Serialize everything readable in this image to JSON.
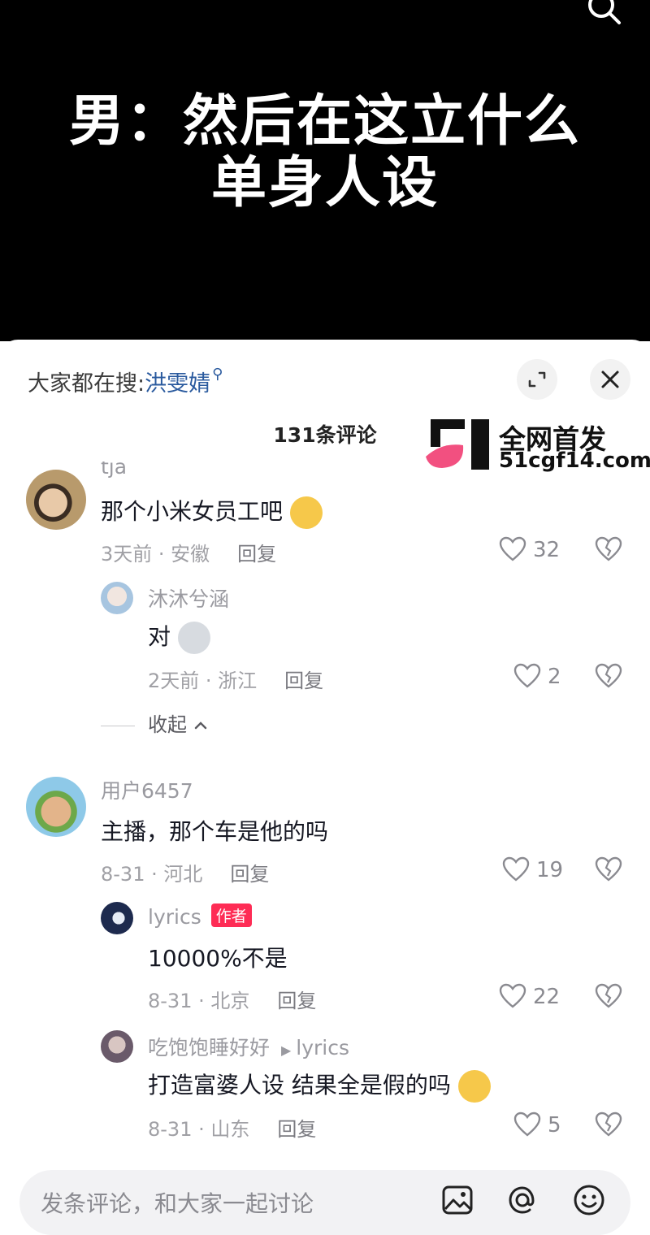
{
  "video": {
    "caption_line1": "男：然后在这立什么",
    "caption_line2": "单身人设",
    "search_icon": "search-icon"
  },
  "sheet": {
    "hot_search_prefix": "大家都在搜:",
    "hot_search_keyword": "洪雯婧",
    "comment_count": "131条评论",
    "watermark_line1": "全网首发",
    "watermark_line2": "51cgf14.com"
  },
  "comments": [
    {
      "username": "tja",
      "text": "那个小米女员工吧",
      "time_location": "3天前 · 安徽",
      "reply_label": "回复",
      "likes": "32",
      "replies": [
        {
          "username": "沐沐兮涵",
          "text": "对",
          "time_location": "2天前 · 浙江",
          "reply_label": "回复",
          "likes": "2"
        }
      ],
      "collapse_label": "收起"
    },
    {
      "username": "用户6457",
      "text": "主播，那个车是他的吗",
      "time_location": "8-31 · 河北",
      "reply_label": "回复",
      "likes": "19",
      "replies": [
        {
          "username": "lyrics",
          "badge": "作者",
          "text": "10000%不是",
          "time_location": "8-31 · 北京",
          "reply_label": "回复",
          "likes": "22"
        },
        {
          "username": "吃饱饱睡好好",
          "reply_to": "lyrics",
          "text": "打造富婆人设 结果全是假的吗",
          "time_location": "8-31 · 山东",
          "reply_label": "回复",
          "likes": "5"
        }
      ]
    }
  ],
  "input": {
    "placeholder": "发条评论，和大家一起讨论"
  },
  "colors": {
    "accent_red": "#fe2c55",
    "link_blue": "#2a5a9e",
    "muted_text": "#a0a0a5"
  }
}
